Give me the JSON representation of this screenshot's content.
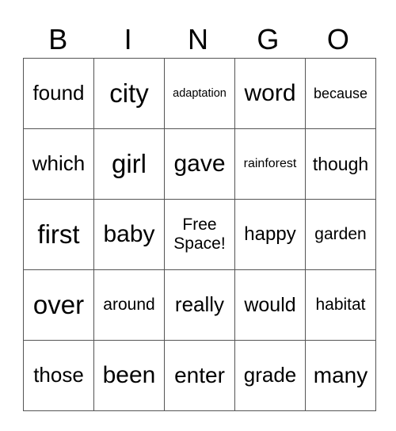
{
  "header": [
    "B",
    "I",
    "N",
    "G",
    "O"
  ],
  "rows": [
    [
      "found",
      "city",
      "adaptation",
      "word",
      "because"
    ],
    [
      "which",
      "girl",
      "gave",
      "rainforest",
      "though"
    ],
    [
      "first",
      "baby",
      "Free Space!",
      "happy",
      "garden"
    ],
    [
      "over",
      "around",
      "really",
      "would",
      "habitat"
    ],
    [
      "those",
      "been",
      "enter",
      "grade",
      "many"
    ]
  ]
}
